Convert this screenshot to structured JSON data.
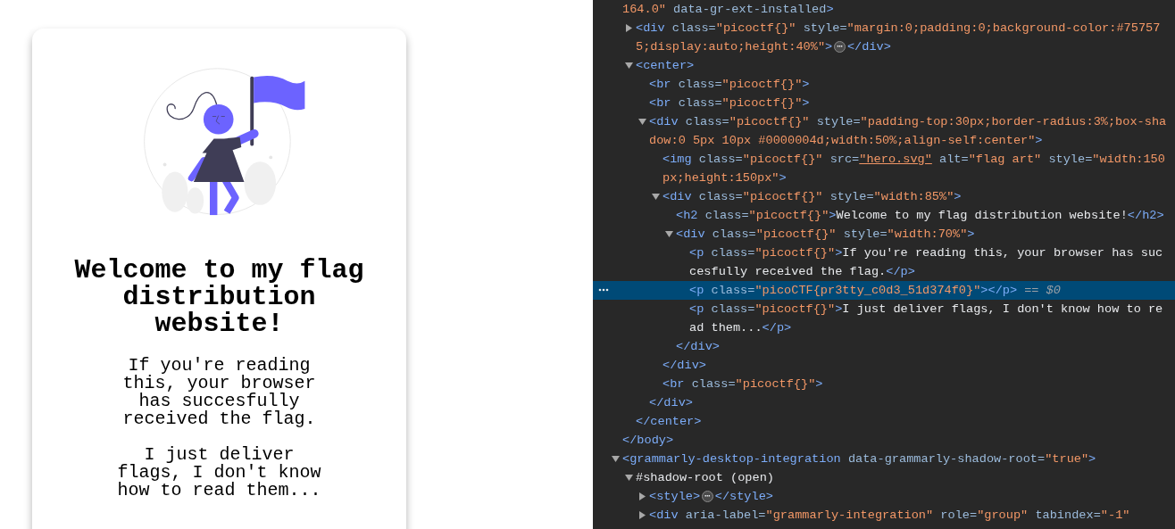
{
  "page": {
    "heading": "Welcome to my flag distribution website!",
    "paragraphs": [
      "If you're reading this, your browser has succesfully received the flag.",
      "I just deliver flags, I don't know how to read them..."
    ]
  },
  "devtools": {
    "nodes": [
      {
        "selected": false,
        "open": [
          {
            "kind": "value",
            "text": "164.0\""
          },
          {
            "kind": "attr",
            "text": " data-gr-ext-installed"
          },
          {
            "kind": "tag",
            "text": ">"
          }
        ],
        "close": [
          {
            "kind": "tag",
            "text": "</body>"
          }
        ],
        "children": [
          {
            "selected": false,
            "expanded": false,
            "badge": "⋯",
            "open": [
              {
                "kind": "tag",
                "text": "<div"
              },
              {
                "kind": "attr",
                "text": " class="
              },
              {
                "kind": "value",
                "text": "\"picoctf{}\""
              },
              {
                "kind": "attr",
                "text": " style="
              },
              {
                "kind": "value",
                "text": "\"margin:0;padding:0;background-color:#757575;display:auto;height:40%\""
              },
              {
                "kind": "tag",
                "text": ">"
              }
            ],
            "close": [
              {
                "kind": "tag",
                "text": "</div>"
              }
            ]
          },
          {
            "selected": false,
            "expanded": true,
            "open": [
              {
                "kind": "tag",
                "text": "<center>"
              }
            ],
            "close": [
              {
                "kind": "tag",
                "text": "</center>"
              }
            ],
            "children": [
              {
                "selected": false,
                "open": [
                  {
                    "kind": "tag",
                    "text": "<br"
                  },
                  {
                    "kind": "attr",
                    "text": " class="
                  },
                  {
                    "kind": "value",
                    "text": "\"picoctf{}\""
                  },
                  {
                    "kind": "tag",
                    "text": ">"
                  }
                ]
              },
              {
                "selected": false,
                "open": [
                  {
                    "kind": "tag",
                    "text": "<br"
                  },
                  {
                    "kind": "attr",
                    "text": " class="
                  },
                  {
                    "kind": "value",
                    "text": "\"picoctf{}\""
                  },
                  {
                    "kind": "tag",
                    "text": ">"
                  }
                ]
              },
              {
                "selected": false,
                "expanded": true,
                "open": [
                  {
                    "kind": "tag",
                    "text": "<div"
                  },
                  {
                    "kind": "attr",
                    "text": " class="
                  },
                  {
                    "kind": "value",
                    "text": "\"picoctf{}\""
                  },
                  {
                    "kind": "attr",
                    "text": " style="
                  },
                  {
                    "kind": "value",
                    "text": "\"padding-top:30px;border-radius:3%;box-shadow:0 5px 10px #0000004d;width:50%;align-self:center\""
                  },
                  {
                    "kind": "tag",
                    "text": ">"
                  }
                ],
                "close": [
                  {
                    "kind": "tag",
                    "text": "</div>"
                  }
                ],
                "children": [
                  {
                    "selected": false,
                    "open": [
                      {
                        "kind": "tag",
                        "text": "<img"
                      },
                      {
                        "kind": "attr",
                        "text": " class="
                      },
                      {
                        "kind": "value",
                        "text": "\"picoctf{}\""
                      },
                      {
                        "kind": "attr",
                        "text": " src="
                      },
                      {
                        "kind": "link",
                        "text": "\"hero.svg\""
                      },
                      {
                        "kind": "attr",
                        "text": " alt="
                      },
                      {
                        "kind": "value",
                        "text": "\"flag art\""
                      },
                      {
                        "kind": "attr",
                        "text": " style="
                      },
                      {
                        "kind": "value",
                        "text": "\"width:150px;height:150px\""
                      },
                      {
                        "kind": "tag",
                        "text": ">"
                      }
                    ]
                  },
                  {
                    "selected": false,
                    "expanded": true,
                    "open": [
                      {
                        "kind": "tag",
                        "text": "<div"
                      },
                      {
                        "kind": "attr",
                        "text": " class="
                      },
                      {
                        "kind": "value",
                        "text": "\"picoctf{}\""
                      },
                      {
                        "kind": "attr",
                        "text": " style="
                      },
                      {
                        "kind": "value",
                        "text": "\"width:85%\""
                      },
                      {
                        "kind": "tag",
                        "text": ">"
                      }
                    ],
                    "close": [
                      {
                        "kind": "tag",
                        "text": "</div>"
                      }
                    ],
                    "children": [
                      {
                        "selected": false,
                        "open": [
                          {
                            "kind": "tag",
                            "text": "<h2"
                          },
                          {
                            "kind": "attr",
                            "text": " class="
                          },
                          {
                            "kind": "value",
                            "text": "\"picoctf{}\""
                          },
                          {
                            "kind": "tag",
                            "text": ">"
                          },
                          {
                            "kind": "text",
                            "text": "Welcome to my flag distribution website!"
                          },
                          {
                            "kind": "tag",
                            "text": "</h2>"
                          }
                        ]
                      },
                      {
                        "selected": false,
                        "expanded": true,
                        "open": [
                          {
                            "kind": "tag",
                            "text": "<div"
                          },
                          {
                            "kind": "attr",
                            "text": " class="
                          },
                          {
                            "kind": "value",
                            "text": "\"picoctf{}\""
                          },
                          {
                            "kind": "attr",
                            "text": " style="
                          },
                          {
                            "kind": "value",
                            "text": "\"width:70%\""
                          },
                          {
                            "kind": "tag",
                            "text": ">"
                          }
                        ],
                        "close": [
                          {
                            "kind": "tag",
                            "text": "</div>"
                          }
                        ],
                        "children": [
                          {
                            "selected": false,
                            "open": [
                              {
                                "kind": "tag",
                                "text": "<p"
                              },
                              {
                                "kind": "attr",
                                "text": " class="
                              },
                              {
                                "kind": "value",
                                "text": "\"picoctf{}\""
                              },
                              {
                                "kind": "tag",
                                "text": ">"
                              },
                              {
                                "kind": "text",
                                "text": "If you're reading this, your browser has succesfully received the flag."
                              },
                              {
                                "kind": "tag",
                                "text": "</p>"
                              }
                            ]
                          },
                          {
                            "selected": true,
                            "note": "== $0",
                            "open": [
                              {
                                "kind": "tag",
                                "text": "<p"
                              },
                              {
                                "kind": "attr",
                                "text": " class="
                              },
                              {
                                "kind": "value",
                                "text": "\"picoCTF{pr3tty_c0d3_51d374f0}\""
                              },
                              {
                                "kind": "tag",
                                "text": "></p>"
                              }
                            ]
                          },
                          {
                            "selected": false,
                            "open": [
                              {
                                "kind": "tag",
                                "text": "<p"
                              },
                              {
                                "kind": "attr",
                                "text": " class="
                              },
                              {
                                "kind": "value",
                                "text": "\"picoctf{}\""
                              },
                              {
                                "kind": "tag",
                                "text": ">"
                              },
                              {
                                "kind": "text",
                                "text": "I just deliver flags, I don't know how to read them..."
                              },
                              {
                                "kind": "tag",
                                "text": "</p>"
                              }
                            ]
                          }
                        ]
                      }
                    ]
                  },
                  {
                    "selected": false,
                    "open": [
                      {
                        "kind": "tag",
                        "text": "<br"
                      },
                      {
                        "kind": "attr",
                        "text": " class="
                      },
                      {
                        "kind": "value",
                        "text": "\"picoctf{}\""
                      },
                      {
                        "kind": "tag",
                        "text": ">"
                      }
                    ]
                  }
                ]
              }
            ]
          }
        ]
      },
      {
        "selected": false,
        "expanded": true,
        "open": [
          {
            "kind": "tag",
            "text": "<grammarly-desktop-integration"
          },
          {
            "kind": "attr",
            "text": " data-grammarly-shadow-root="
          },
          {
            "kind": "value",
            "text": "\"true\""
          },
          {
            "kind": "tag",
            "text": ">"
          }
        ],
        "children": [
          {
            "selected": false,
            "expanded": true,
            "open": [
              {
                "kind": "text",
                "text": "#shadow-root (open)"
              }
            ],
            "children": [
              {
                "selected": false,
                "expanded": false,
                "badge": "⋯",
                "open": [
                  {
                    "kind": "tag",
                    "text": "<style>"
                  }
                ],
                "close": [
                  {
                    "kind": "tag",
                    "text": "</style>"
                  }
                ]
              },
              {
                "selected": false,
                "expanded": false,
                "open": [
                  {
                    "kind": "tag",
                    "text": "<div"
                  },
                  {
                    "kind": "attr",
                    "text": " aria-label="
                  },
                  {
                    "kind": "value",
                    "text": "\"grammarly-integration\""
                  },
                  {
                    "kind": "attr",
                    "text": " role="
                  },
                  {
                    "kind": "value",
                    "text": "\"group\""
                  },
                  {
                    "kind": "attr",
                    "text": " tabindex="
                  },
                  {
                    "kind": "value",
                    "text": "\"-1\""
                  }
                ]
              }
            ]
          }
        ]
      }
    ]
  }
}
